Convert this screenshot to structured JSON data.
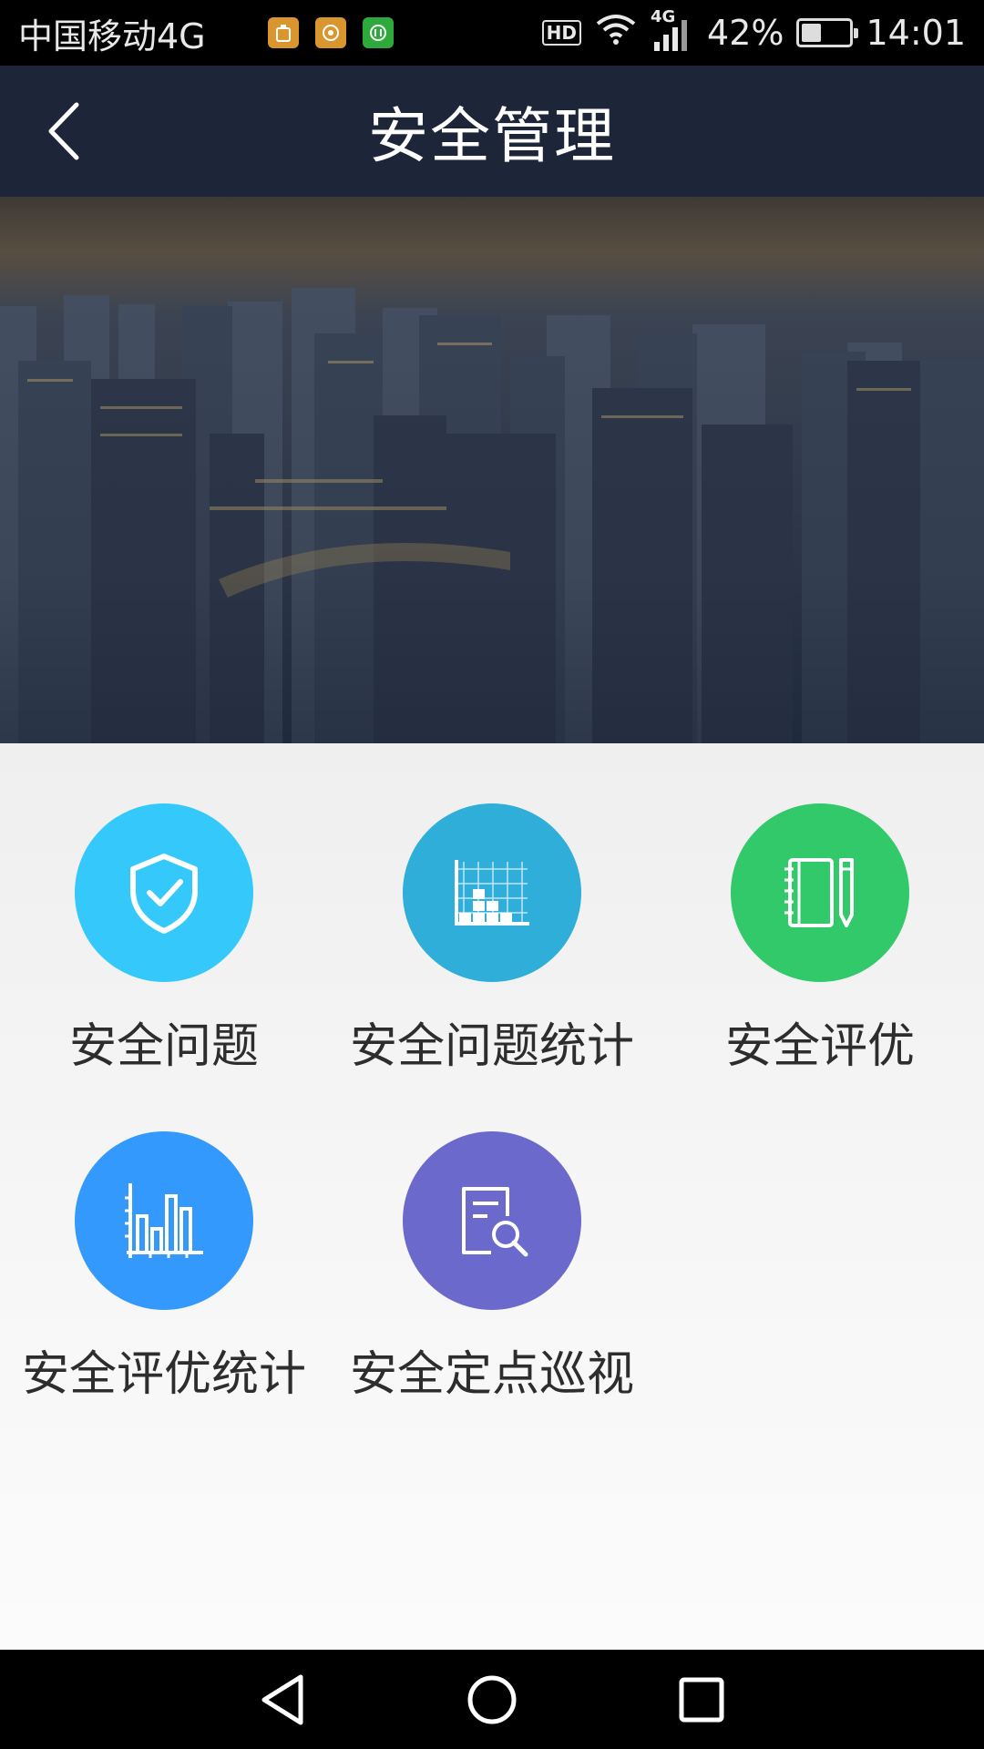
{
  "status_bar": {
    "carrier": "中国移动4G",
    "hd_label": "HD",
    "network_label": "4G",
    "battery_percent": "42%",
    "battery_level": 0.42,
    "time": "14:01"
  },
  "header": {
    "title": "安全管理"
  },
  "menu": {
    "items": [
      {
        "label": "安全问题",
        "icon": "shield-check-icon",
        "color": "#35c9fb"
      },
      {
        "label": "安全问题统计",
        "icon": "stacked-chart-icon",
        "color": "#2eaed9"
      },
      {
        "label": "安全评优",
        "icon": "notebook-pen-icon",
        "color": "#32c96a"
      },
      {
        "label": "安全评优统计",
        "icon": "bar-chart-icon",
        "color": "#3399fd"
      },
      {
        "label": "安全定点巡视",
        "icon": "document-search-icon",
        "color": "#6c69cc"
      }
    ]
  },
  "colors": {
    "header_bg": "#1c2638",
    "page_bg": "#f2f2f2",
    "label_text": "#2d2d2d"
  }
}
